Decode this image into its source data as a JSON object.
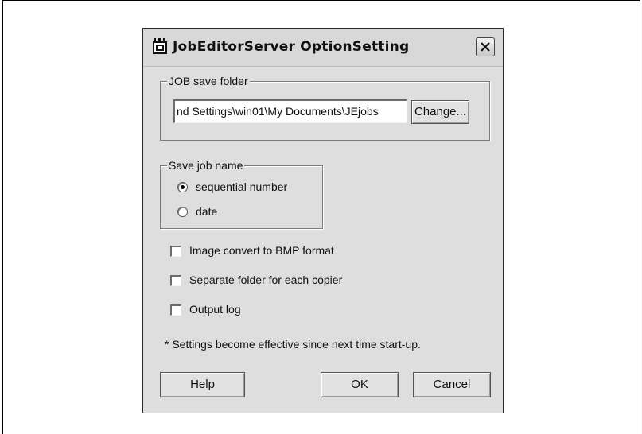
{
  "dialog": {
    "title": "JobEditorServer OptionSetting",
    "close_icon": "close-icon",
    "app_icon": "application-icon"
  },
  "job_save_folder": {
    "legend": "JOB save folder",
    "path_value": "nd Settings\\win01\\My Documents\\JEjobs",
    "change_label": "Change..."
  },
  "save_job_name": {
    "legend": "Save job name",
    "options": [
      {
        "label": "sequential number",
        "selected": true
      },
      {
        "label": "date",
        "selected": false
      }
    ]
  },
  "checkboxes": [
    {
      "label": "Image convert to BMP format",
      "checked": false
    },
    {
      "label": "Separate folder for each copier",
      "checked": false
    },
    {
      "label": "Output log",
      "checked": false
    }
  ],
  "note": "* Settings become effective since next time start-up.",
  "buttons": {
    "help": "Help",
    "ok": "OK",
    "cancel": "Cancel"
  }
}
